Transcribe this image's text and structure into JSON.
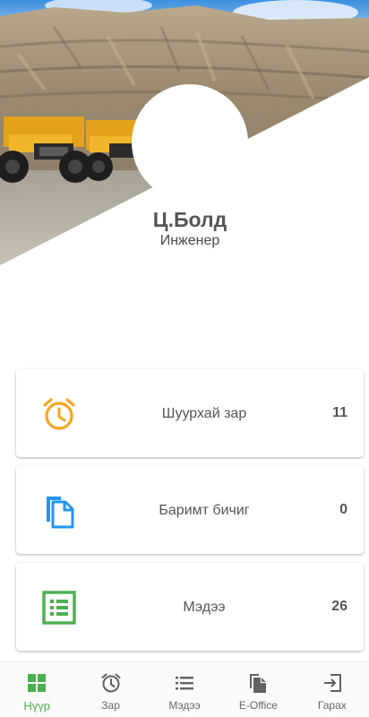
{
  "profile": {
    "name": "Ц.Болд",
    "role": "Инженер"
  },
  "cards": [
    {
      "label": "Шуурхай зар",
      "count": "11",
      "icon": "alarm-clock-icon",
      "color": "#f5a623"
    },
    {
      "label": "Баримт бичиг",
      "count": "0",
      "icon": "documents-icon",
      "color": "#2196f3"
    },
    {
      "label": "Мэдээ",
      "count": "26",
      "icon": "list-icon",
      "color": "#4caf50"
    }
  ],
  "bottom_nav": {
    "active": 0,
    "items": [
      {
        "label": "Нүүр",
        "icon": "home-grid-icon"
      },
      {
        "label": "Зар",
        "icon": "alarm-clock-icon"
      },
      {
        "label": "Мэдээ",
        "icon": "list-icon"
      },
      {
        "label": "E-Office",
        "icon": "documents-icon"
      },
      {
        "label": "Гарах",
        "icon": "logout-icon"
      }
    ]
  },
  "colors": {
    "accent": "#4caf50",
    "text": "#555555"
  }
}
